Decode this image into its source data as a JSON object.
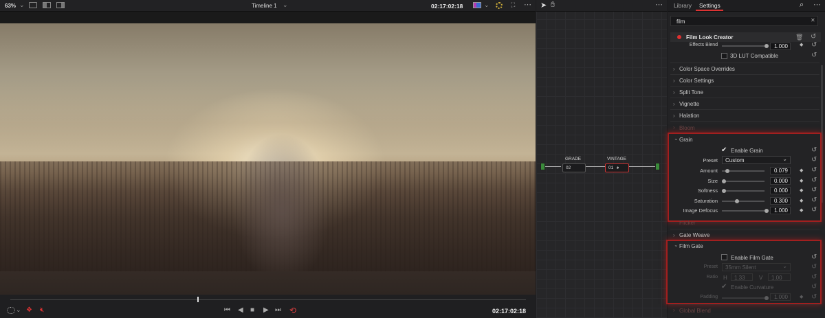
{
  "viewer": {
    "zoom": "63%",
    "timeline_title": "Timeline 1",
    "timecode_top": "02:17:02:18",
    "timecode_bottom": "02:17:02:18"
  },
  "settings": {
    "tabs": [
      "Library",
      "Settings"
    ],
    "search_value": "film",
    "effect_name": "Film Look Creator",
    "effects_blend_label": "Effects Blend",
    "effects_blend_value": "1.000",
    "lut_label": "3D LUT Compatible",
    "sections": [
      "Color Space Overrides",
      "Color Settings",
      "Split Tone",
      "Vignette",
      "Halation",
      "Bloom"
    ],
    "grain": {
      "title": "Grain",
      "enable_label": "Enable Grain",
      "preset_label": "Preset",
      "preset_value": "Custom",
      "params": [
        {
          "label": "Amount",
          "value": "0.079",
          "level": 0.08
        },
        {
          "label": "Size",
          "value": "0.000",
          "level": 0.0
        },
        {
          "label": "Softness",
          "value": "0.000",
          "level": 0.0
        },
        {
          "label": "Saturation",
          "value": "0.300",
          "level": 0.3
        },
        {
          "label": "Image Defocus",
          "value": "1.000",
          "level": 1.0
        }
      ]
    },
    "flicker": "Flicker",
    "gate_weave": "Gate Weave",
    "film_gate": {
      "title": "Film Gate",
      "enable_label": "Enable Film Gate",
      "preset_label": "Preset",
      "preset_value": "35mm Silent",
      "ratio_label": "Ratio",
      "h_label": "H",
      "h_value": "1.33",
      "v_label": "V",
      "v_value": "1.00",
      "curvature_label": "Enable Curvature",
      "padding_label": "Padding",
      "padding_value": "1.000"
    },
    "global_blend": "Global Blend"
  },
  "nodes": [
    {
      "label": "GRADE",
      "number": "02"
    },
    {
      "label": "VINTAGE",
      "number": "01"
    }
  ]
}
